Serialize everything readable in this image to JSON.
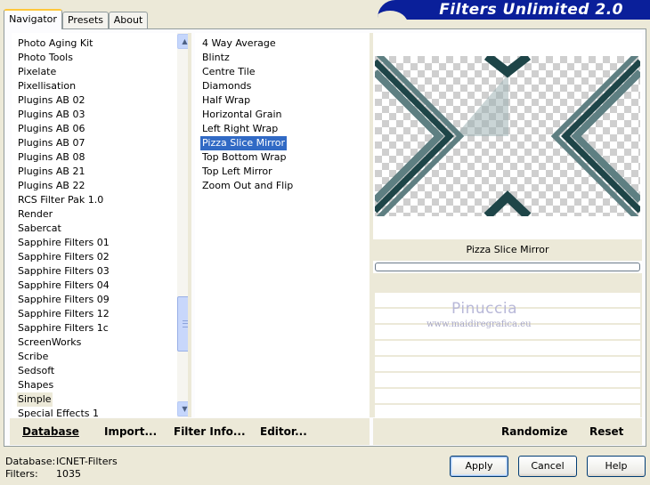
{
  "tabs": [
    {
      "label": "Navigator",
      "active": true
    },
    {
      "label": "Presets",
      "active": false
    },
    {
      "label": "About",
      "active": false
    }
  ],
  "banner": {
    "title": "Filters Unlimited 2.0"
  },
  "categories": {
    "items": [
      "Photo Aging Kit",
      "Photo Tools",
      "Pixelate",
      "Pixellisation",
      "Plugins AB 02",
      "Plugins AB 03",
      "Plugins AB 06",
      "Plugins AB 07",
      "Plugins AB 08",
      "Plugins AB 21",
      "Plugins AB 22",
      "RCS Filter Pak 1.0",
      "Render",
      "Sabercat",
      "Sapphire Filters 01",
      "Sapphire Filters 02",
      "Sapphire Filters 03",
      "Sapphire Filters 04",
      "Sapphire Filters 09",
      "Sapphire Filters 12",
      "Sapphire Filters 1c",
      "ScreenWorks",
      "Scribe",
      "Sedsoft",
      "Shapes",
      "Simple",
      "Special Effects 1"
    ],
    "selected": "Simple"
  },
  "filters": {
    "items": [
      "4 Way Average",
      "Blintz",
      "Centre Tile",
      "Diamonds",
      "Half Wrap",
      "Horizontal Grain",
      "Left Right Wrap",
      "Pizza Slice Mirror",
      "Top Bottom Wrap",
      "Top Left Mirror",
      "Zoom Out and Flip"
    ],
    "selected": "Pizza Slice Mirror"
  },
  "preview": {
    "filter_name": "Pizza Slice Mirror",
    "dark_color": "#1E4548",
    "mid_color": "#5E7F82",
    "light_color": "#9FB2B4"
  },
  "watermark": {
    "title": "Pinuccia",
    "url": "www.maidiregrafica.eu"
  },
  "bottom_bar": {
    "database": "Database",
    "import": "Import...",
    "filter_info": "Filter Info...",
    "editor": "Editor...",
    "randomize": "Randomize",
    "reset": "Reset"
  },
  "status": {
    "database_label": "Database:",
    "database_value": "ICNET-Filters",
    "filters_label": "Filters:",
    "filters_value": "1035"
  },
  "dialog": {
    "apply": "Apply",
    "cancel": "Cancel",
    "help": "Help"
  }
}
